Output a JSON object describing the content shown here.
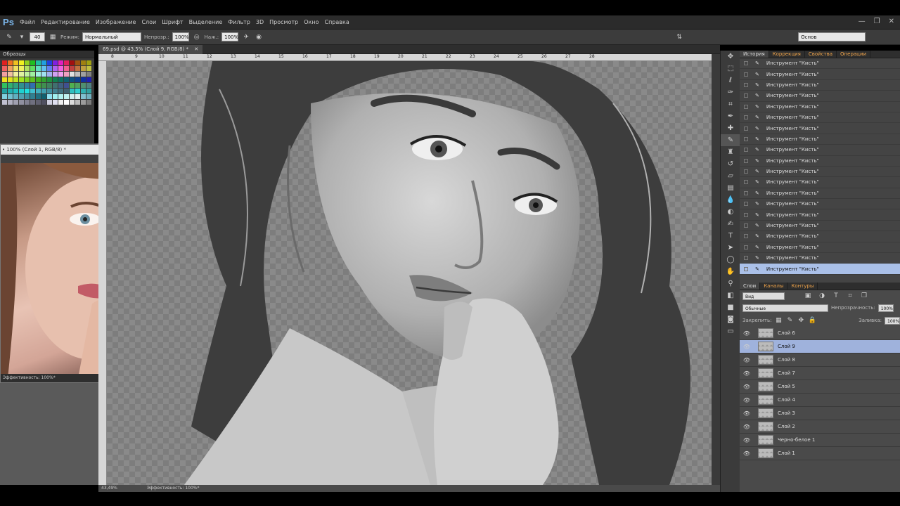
{
  "app": {
    "logo": "Ps"
  },
  "menu": [
    "Файл",
    "Редактирование",
    "Изображение",
    "Слои",
    "Шрифт",
    "Выделение",
    "Фильтр",
    "3D",
    "Просмотр",
    "Окно",
    "Справка"
  ],
  "window_controls": {
    "minimize": "—",
    "restore": "❐",
    "close": "✕"
  },
  "options_bar": {
    "brush_size": "40",
    "mode_label": "Режим:",
    "mode_value": "Нормальный",
    "opacity_label": "Непрозр.:",
    "opacity_value": "100%",
    "flow_label": "Наж.:",
    "flow_value": "100%",
    "workspace_value": "Основ"
  },
  "swatches": {
    "title": "Образцы",
    "colors": [
      "#e02020",
      "#f07020",
      "#f0c020",
      "#f0f020",
      "#90d020",
      "#20c020",
      "#20c0a0",
      "#20a0e0",
      "#2040e0",
      "#8020e0",
      "#e020c0",
      "#e02060",
      "#a01010",
      "#a05010",
      "#a08010",
      "#a0a010",
      "#f06060",
      "#f0a060",
      "#f0e060",
      "#f0f060",
      "#b0e060",
      "#60e060",
      "#60e0c0",
      "#60c0f0",
      "#6080f0",
      "#b060f0",
      "#f060e0",
      "#f06090",
      "#c04040",
      "#c07040",
      "#c0a040",
      "#c0c040",
      "#f0a0a0",
      "#f0c0a0",
      "#f0f0a0",
      "#e0f0a0",
      "#c0f0a0",
      "#a0f0a0",
      "#a0f0e0",
      "#a0e0f0",
      "#a0b0f0",
      "#d0a0f0",
      "#f0a0f0",
      "#f0a0c0",
      "#e0e0e0",
      "#c0c0c0",
      "#a0a0a0",
      "#808080",
      "#f0e020",
      "#e0e020",
      "#c0e020",
      "#a0e020",
      "#80d020",
      "#60c020",
      "#40b020",
      "#30a030",
      "#209040",
      "#108050",
      "#107060",
      "#106070",
      "#105080",
      "#104090",
      "#1030a0",
      "#2020b0",
      "#30c060",
      "#30b070",
      "#30a080",
      "#309090",
      "#3080a0",
      "#3070b0",
      "#40a040",
      "#409050",
      "#408060",
      "#407070",
      "#406080",
      "#405090",
      "#50b050",
      "#50a060",
      "#509070",
      "#508080",
      "#20a0a0",
      "#20b0b0",
      "#20c0c0",
      "#20d0d0",
      "#20e0e0",
      "#40c0d0",
      "#40b0c0",
      "#40a0b0",
      "#4090a0",
      "#408090",
      "#407080",
      "#406070",
      "#30c0c0",
      "#30d0d0",
      "#30b0b0",
      "#30a0a0",
      "#80d0e0",
      "#70c0d0",
      "#60b0c0",
      "#50a0b0",
      "#4090a0",
      "#308090",
      "#207080",
      "#106070",
      "#90e0f0",
      "#a0f0f0",
      "#b0f0f0",
      "#c0f0f0",
      "#d0f0f0",
      "#e0f0f0",
      "#80c0d0",
      "#70b0c0",
      "#c0c0d0",
      "#b0b0c0",
      "#a0a0b0",
      "#9090a0",
      "#808090",
      "#707080",
      "#606070",
      "#505060",
      "#d0d0e0",
      "#e0e0f0",
      "#f0f0f0",
      "#ffffff",
      "#dcdcdc",
      "#bcbcbc",
      "#9c9c9c",
      "#7c7c7c"
    ]
  },
  "reference_window": {
    "title": "• 100% (Слой 1, RGB/8) *",
    "status": "Эффективность: 100%*"
  },
  "document": {
    "tab_title": "69.psd @ 43,5% (Слой 9, RGB/8) *",
    "ruler_ticks": [
      "8",
      "9",
      "10",
      "11",
      "12",
      "13",
      "14",
      "15",
      "16",
      "17",
      "18",
      "19",
      "20",
      "21",
      "22",
      "23",
      "24",
      "25",
      "26",
      "27",
      "28"
    ],
    "zoom": "43,49%",
    "status": "Эффективность: 100%*"
  },
  "history": {
    "tabs": [
      "История",
      "Коррекция",
      "Свойства",
      "Операции"
    ],
    "items": [
      "Инструмент \"Кисть\"",
      "Инструмент \"Кисть\"",
      "Инструмент \"Кисть\"",
      "Инструмент \"Кисть\"",
      "Инструмент \"Кисть\"",
      "Инструмент \"Кисть\"",
      "Инструмент \"Кисть\"",
      "Инструмент \"Кисть\"",
      "Инструмент \"Кисть\"",
      "Инструмент \"Кисть\"",
      "Инструмент \"Кисть\"",
      "Инструмент \"Кисть\"",
      "Инструмент \"Кисть\"",
      "Инструмент \"Кисть\"",
      "Инструмент \"Кисть\"",
      "Инструмент \"Кисть\"",
      "Инструмент \"Кисть\"",
      "Инструмент \"Кисть\"",
      "Инструмент \"Кисть\"",
      "Инструмент \"Кисть\""
    ]
  },
  "layers": {
    "tabs": [
      "Слои",
      "Каналы",
      "Контуры"
    ],
    "filter": "Вид",
    "blend_mode": "Обычные",
    "opacity_label": "Непрозрачность:",
    "opacity_value": "100%",
    "lock_label": "Закрепить:",
    "fill_label": "Заливка:",
    "fill_value": "100%",
    "items": [
      {
        "name": "Слой 6",
        "selected": false
      },
      {
        "name": "Слой 9",
        "selected": true
      },
      {
        "name": "Слой 8",
        "selected": false
      },
      {
        "name": "Слой 7",
        "selected": false
      },
      {
        "name": "Слой 5",
        "selected": false
      },
      {
        "name": "Слой 4",
        "selected": false
      },
      {
        "name": "Слой 3",
        "selected": false
      },
      {
        "name": "Слой 2",
        "selected": false
      },
      {
        "name": "Черно-белое 1",
        "selected": false
      },
      {
        "name": "Слой 1",
        "selected": false
      }
    ]
  }
}
